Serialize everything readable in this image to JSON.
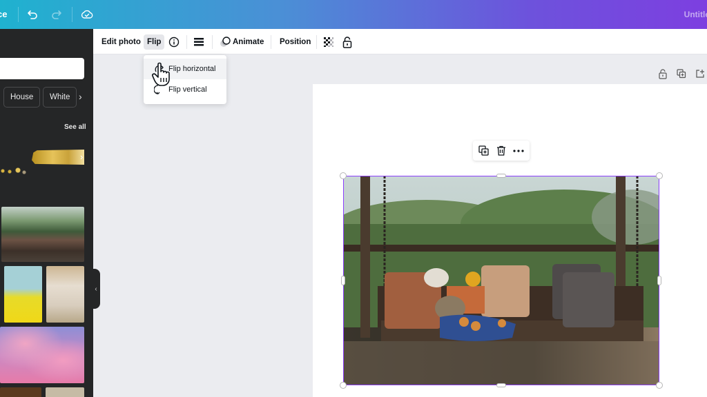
{
  "topbar": {
    "brand_partial": "ce",
    "title_partial": "Untitle",
    "icons": [
      "undo-icon",
      "redo-icon",
      "cloud-saved-icon"
    ]
  },
  "sidebar": {
    "search_placeholder": "",
    "chips": [
      "House",
      "White"
    ],
    "see_all": "See all",
    "thumbnails": [
      "gold-brush-stroke",
      "porch-swing-photo",
      "woman-yellow-dress",
      "elderly-woman-white",
      "pink-clouds",
      "dark-photo",
      "light-photo"
    ]
  },
  "toolbar": {
    "edit_photo": "Edit photo",
    "flip": "Flip",
    "animate": "Animate",
    "position": "Position",
    "icons": [
      "info-icon",
      "border-style-icon",
      "animate-icon",
      "transparency-icon",
      "lock-icon"
    ]
  },
  "flip_menu": {
    "items": [
      {
        "label": "Flip horizontal",
        "hovered": true
      },
      {
        "label": "Flip vertical",
        "hovered": false
      }
    ]
  },
  "page_controls": [
    "lock-page-icon",
    "duplicate-page-icon",
    "add-page-icon"
  ],
  "element_toolbar": [
    "duplicate-icon",
    "delete-icon",
    "more-icon"
  ],
  "colors": {
    "accent": "#8b3dff",
    "sidebar_bg": "#252627",
    "topbar_start": "#1fb2cf",
    "topbar_end": "#7d3fe0"
  }
}
